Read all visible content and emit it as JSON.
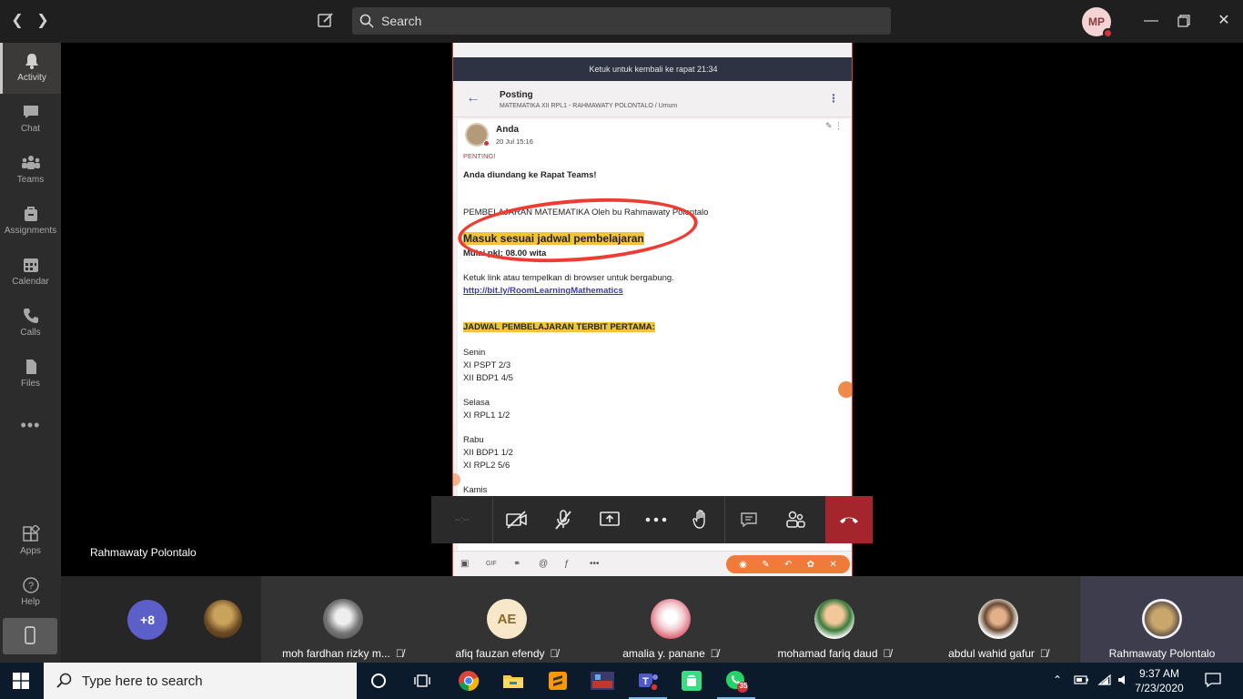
{
  "titlebar": {
    "search_placeholder": "Search",
    "profile_initials": "MP"
  },
  "rail": {
    "items": [
      {
        "label": "Activity",
        "icon": "bell-icon"
      },
      {
        "label": "Chat",
        "icon": "chat-icon"
      },
      {
        "label": "Teams",
        "icon": "teams-icon"
      },
      {
        "label": "Assignments",
        "icon": "assignments-icon"
      },
      {
        "label": "Calendar",
        "icon": "calendar-icon"
      },
      {
        "label": "Calls",
        "icon": "phone-icon"
      },
      {
        "label": "Files",
        "icon": "file-icon"
      }
    ],
    "more": "•••",
    "apps": "Apps",
    "help": "Help"
  },
  "shared_screen": {
    "banner": "Ketuk untuk kembali ke rapat 21:34",
    "post_title": "Posting",
    "post_channel": "MATEMATIKA XII RPL1 - RAHMAWATY POLONTALO / Umum",
    "author": "Anda",
    "date": "20 Jul 15:16",
    "important": "PENTING!",
    "headline": "Anda diundang ke Rapat Teams!",
    "line_course": "PEMBELAJARAN MATEMATIKA Oleh bu Rahmawaty Polontalo",
    "schedule_note": "Masuk sesuai jadwal pembelajaran",
    "start_time": "Mulai pkl: 08.00 wita",
    "join_hint": "Ketuk link atau tempelkan di browser untuk bergabung.",
    "link": "http://bit.ly/RoomLearningMathematics",
    "schedule_title": "JADWAL PEMBELAJARAN TERBIT PERTAMA:",
    "days": [
      {
        "day": "Senin",
        "classes": [
          "XI PSPT 2/3",
          "XII BDP1 4/5"
        ]
      },
      {
        "day": "Selasa",
        "classes": [
          "XI RPL1 1/2"
        ]
      },
      {
        "day": "Rabu",
        "classes": [
          "XII BDP1 1/2",
          "XI RPL2 5/6"
        ]
      },
      {
        "day": "Kamis",
        "classes": []
      }
    ]
  },
  "speaker_name": "Rahmawaty Polontalo",
  "call_controls": {
    "timer": "--:--"
  },
  "participants": {
    "overflow": "+8",
    "tiles": [
      {
        "name": "moh fardhan rizky m...",
        "initials": "",
        "avatar": "photo-cat"
      },
      {
        "name": "afiq fauzan efendy",
        "initials": "AE",
        "avatar": "initials"
      },
      {
        "name": "amalia y. panane",
        "initials": "",
        "avatar": "photo-doll"
      },
      {
        "name": "mohamad fariq daud",
        "initials": "",
        "avatar": "photo-cartoon"
      },
      {
        "name": "abdul wahid gafur",
        "initials": "",
        "avatar": "photo-emoji"
      },
      {
        "name": "Rahmawaty Polontalo",
        "initials": "",
        "avatar": "photo-hijab"
      }
    ]
  },
  "taskbar": {
    "search_placeholder": "Type here to search",
    "whatsapp_badge": "35",
    "time": "9:37 AM",
    "date": "7/23/2020"
  }
}
